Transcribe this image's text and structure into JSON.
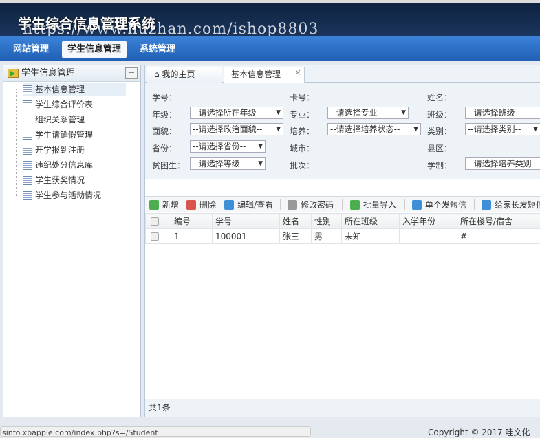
{
  "header": {
    "title": "学生综合信息管理系统",
    "watermark": "https://www.huzhan.com/ishop8803"
  },
  "nav": [
    "网站管理",
    "学生信息管理",
    "系统管理"
  ],
  "left": {
    "title": "学生信息管理",
    "collapse": "−",
    "items": [
      "基本信息管理",
      "学生综合评价表",
      "组织关系管理",
      "学生请销假管理",
      "开学报到注册",
      "违纪处分信息库",
      "学生获奖情况",
      "学生参与活动情况"
    ]
  },
  "tabs": [
    {
      "label": "我的主页"
    },
    {
      "label": "基本信息管理",
      "close": "×"
    }
  ],
  "form": {
    "labels": [
      "学号：",
      "卡号：",
      "姓名：",
      "年级：",
      "专业：",
      "班级：",
      "面貌：",
      "培养：",
      "类别：",
      "省份：",
      "城市：",
      "县区：",
      "贫困生：",
      "批次：",
      "学制："
    ],
    "selects": [
      "--请选择所在年级--",
      "--请选择专业--",
      "--请选择班级--",
      "--请选择政治面貌--",
      "--请选择培养状态--",
      "--请选择类别--",
      "--请选择省份--",
      "--请选择等级--",
      "--请选择培养类别--"
    ]
  },
  "toolbar": [
    "新增",
    "删除",
    "编辑/查看",
    "修改密码",
    "批量导入",
    "单个发短信",
    "给家长发短信"
  ],
  "table": {
    "headers": [
      "编号",
      "学号",
      "姓名",
      "性别",
      "所在班级",
      "入学年份",
      "所在楼号/宿舍"
    ],
    "rows": [
      [
        "1",
        "100001",
        "张三",
        "男",
        "未知",
        "",
        "#"
      ]
    ]
  },
  "footer": "共1条",
  "status_url": "sinfo.xbapple.com/index.php?s=/Student",
  "copyright": "Copyright © 2017 哇文化"
}
